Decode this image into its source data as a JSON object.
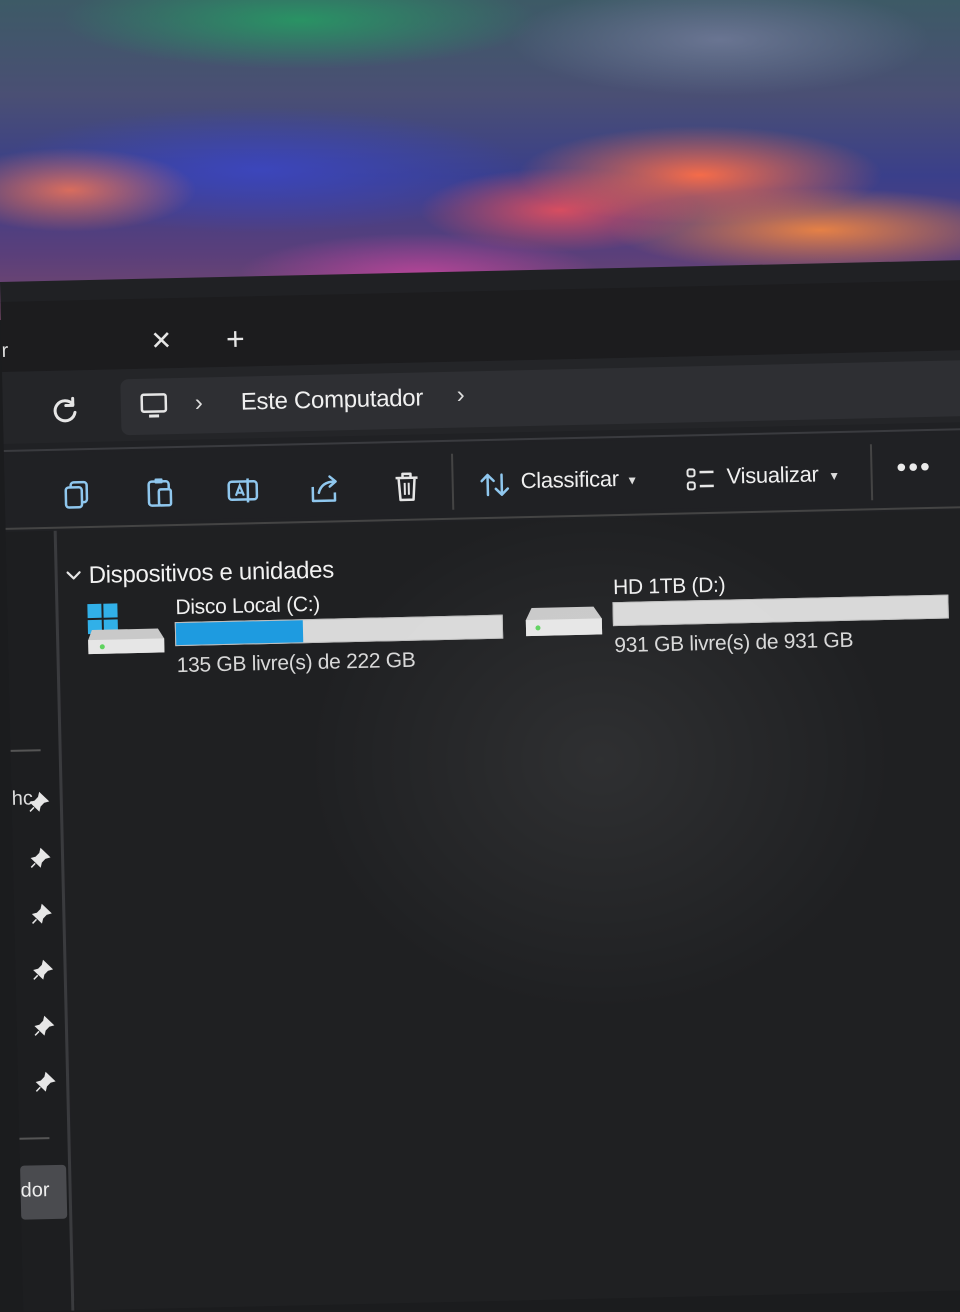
{
  "window": {
    "tab_fragment": "r",
    "tab_close_glyph": "✕",
    "tab_new_glyph": "+"
  },
  "address": {
    "icon": "computer-icon",
    "breadcrumb": "Este Computador",
    "separator": "›"
  },
  "toolbar": {
    "icons": [
      "copy-icon",
      "paste-icon",
      "rename-icon",
      "share-icon",
      "delete-icon"
    ],
    "sort_label": "Classificar",
    "view_label": "Visualizar",
    "more_label": "•••"
  },
  "sidebar": {
    "fragment_top": "hc",
    "fragment_bottom": "dor",
    "pinned_count": 6
  },
  "content": {
    "section_title": "Dispositivos e unidades",
    "drives": [
      {
        "name": "Disco Local (C:)",
        "free_text": "135 GB livre(s) de 222 GB",
        "used_fraction": 0.39,
        "icon": "windows-drive-icon"
      },
      {
        "name": "HD 1TB (D:)",
        "free_text": "931 GB livre(s) de 931 GB",
        "used_fraction": 0.0,
        "icon": "hard-drive-icon"
      }
    ]
  },
  "colors": {
    "accent": "#1e9be0",
    "background": "#202124"
  }
}
